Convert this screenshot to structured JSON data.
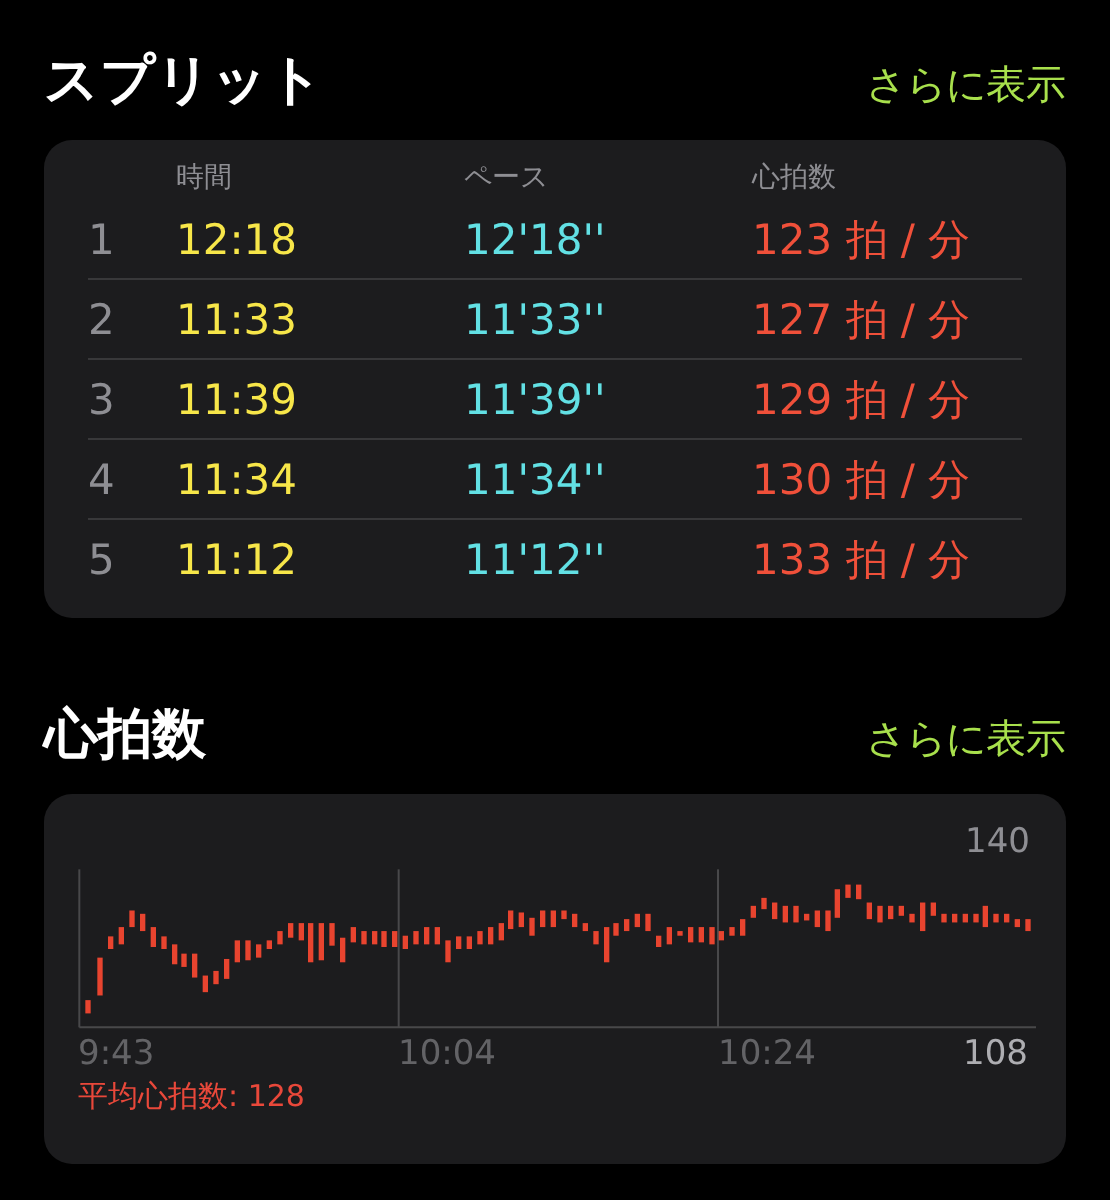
{
  "splits": {
    "title": "スプリット",
    "more": "さらに表示",
    "columns": [
      "時間",
      "ペース",
      "心拍数"
    ],
    "rows": [
      {
        "index": "1",
        "time": "12:18",
        "pace": "12'18''",
        "heart_rate": "123 拍 / 分"
      },
      {
        "index": "2",
        "time": "11:33",
        "pace": "11'33''",
        "heart_rate": "127 拍 / 分"
      },
      {
        "index": "3",
        "time": "11:39",
        "pace": "11'39''",
        "heart_rate": "129 拍 / 分"
      },
      {
        "index": "4",
        "time": "11:34",
        "pace": "11'34''",
        "heart_rate": "130 拍 / 分"
      },
      {
        "index": "5",
        "time": "11:12",
        "pace": "11'12''",
        "heart_rate": "133 拍 / 分"
      }
    ]
  },
  "heart_rate": {
    "title": "心拍数",
    "more": "さらに表示",
    "y_max": "140",
    "y_min": "108",
    "x_labels": [
      "9:43",
      "10:04",
      "10:24"
    ],
    "average": "平均心拍数: 128"
  }
}
